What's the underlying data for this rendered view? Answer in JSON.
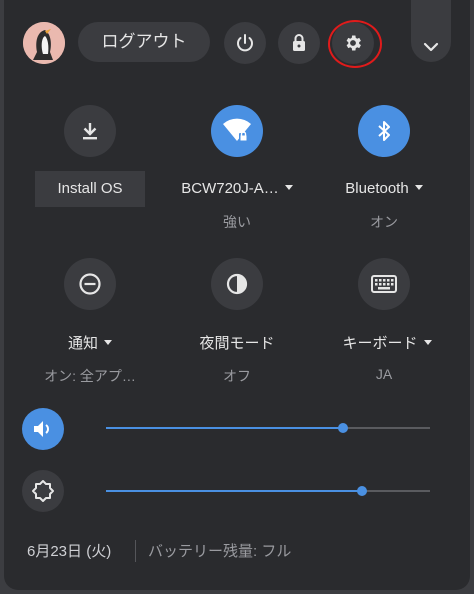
{
  "header": {
    "signout_label": "ログアウト"
  },
  "pods": [
    {
      "label": "Install OS",
      "sub": "",
      "icon": "download-icon"
    },
    {
      "label": "BCW720J-A…",
      "sub": "強い",
      "icon": "wifi-lock-icon"
    },
    {
      "label": "Bluetooth",
      "sub": "オン",
      "icon": "bluetooth-icon"
    },
    {
      "label": "通知",
      "sub": "オン: 全アプ…",
      "icon": "do-not-disturb-icon"
    },
    {
      "label": "夜間モード",
      "sub": "オフ",
      "icon": "night-light-icon"
    },
    {
      "label": "キーボード",
      "sub": "JA",
      "icon": "keyboard-icon"
    }
  ],
  "sliders": {
    "volume": {
      "level": 0.73,
      "icon": "volume-icon"
    },
    "brightness": {
      "level": 0.79,
      "icon": "brightness-icon"
    }
  },
  "footer": {
    "date": "6月23日 (火)",
    "battery": "バッテリー残量: フル"
  },
  "colors": {
    "accent": "#4a90e2",
    "highlight_ring": "#e01b1b"
  }
}
